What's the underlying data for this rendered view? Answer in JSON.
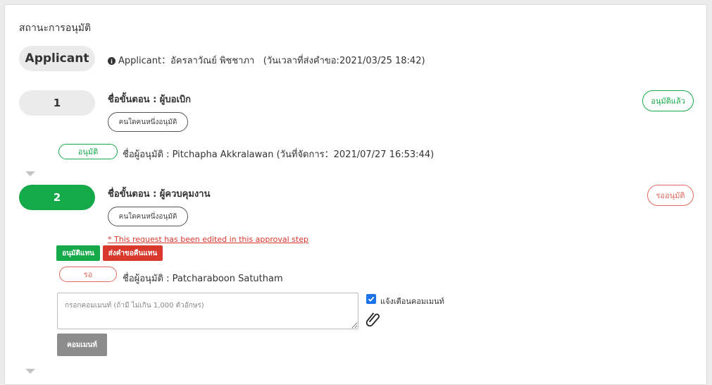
{
  "section_title": "สถานะการอนุมัติ",
  "applicant": {
    "badge": "Applicant",
    "info_label": "Applicant",
    "info_sep": "：",
    "name": "อัครลาวัณย์ พิชชาภา",
    "date_text": "(วันเวลาที่ส่งคำขอ:2021/03/25 18:42)"
  },
  "step1": {
    "number": "1",
    "name": "ชื่อขั้นตอน : ผู้บอเบิก",
    "rule": "คนใดคนหนึ่งอนุมัติ",
    "status": "อนุมัติแล้ว",
    "approver_status": "อนุมัติ",
    "approver_text": "ชื่อผู้อนุมัติ : Pitchapha Akkralawan (วันที่จัดการ：2021/07/27 16:53:44)"
  },
  "step2": {
    "number": "2",
    "name": "ชื่อขั้นตอน : ผู้ควบคุมงาน",
    "rule": "คนใดคนหนึ่งอนุมัติ",
    "status": "รออนุมัติ",
    "edited_note": "* This request has been edited in this approval step",
    "approve_on_behalf": "อนุมัติแทน",
    "return_on_behalf": "ส่งคำขอคืนแทน",
    "approver_status": "รอ",
    "approver_text": "ชื่อผู้อนุมัติ : Patcharaboon Satutham",
    "comment_placeholder": "กรอกคอมเมนท์ (ถ้ามี ไม่เกิน 1,000 ตัวอักษร)",
    "notify_label": "แจ้งเตือนคอมเมนท์",
    "notify_checked": true,
    "comment_button": "คอมเมนท์"
  },
  "colors": {
    "green": "#16a94a",
    "red": "#d9382c",
    "pending_red": "#e0695f",
    "grey_pill": "#ebebeb",
    "checkbox_blue": "#1a73e8"
  }
}
